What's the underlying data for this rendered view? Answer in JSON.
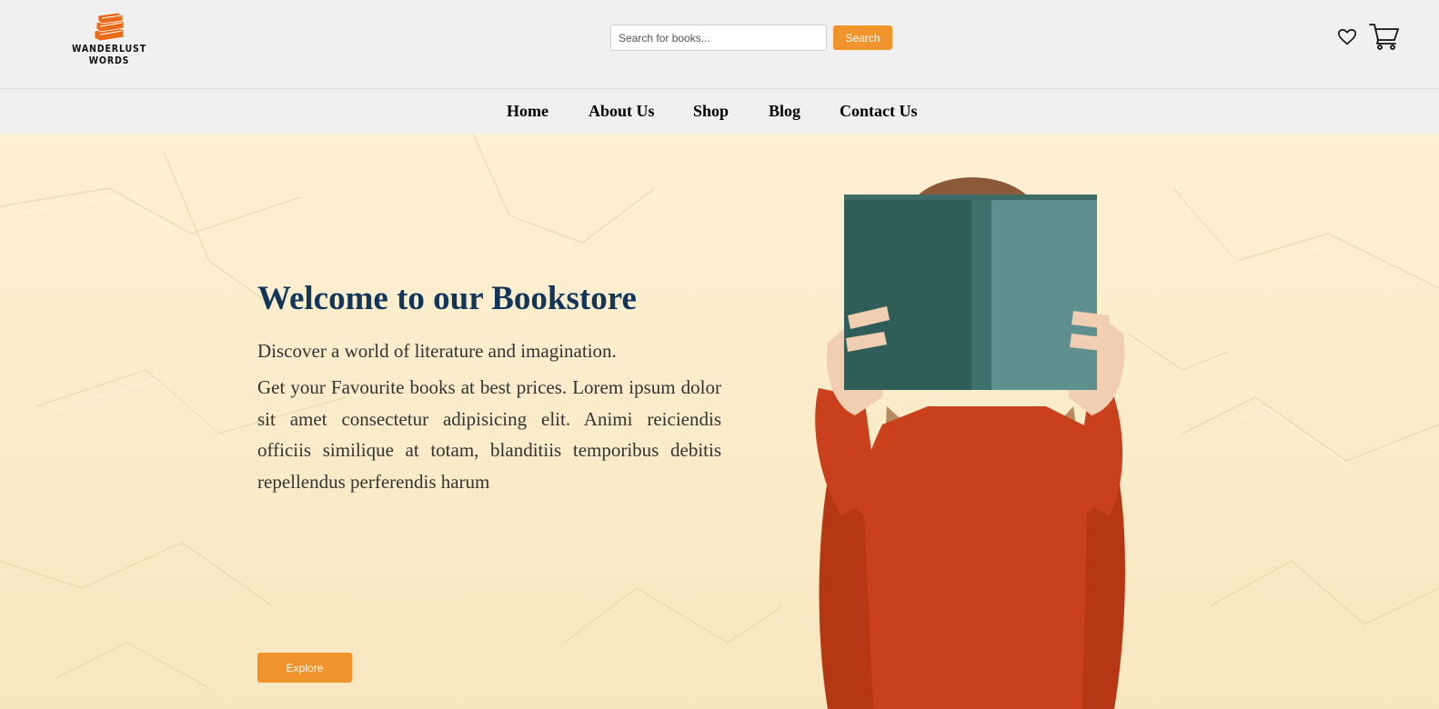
{
  "brand": {
    "name": "WANDERLUST WORDS",
    "logo_icon": "book-stack-icon",
    "accent": "#f0932b"
  },
  "search": {
    "placeholder": "Search for books...",
    "value": "",
    "button_label": "Search"
  },
  "header_icons": {
    "wishlist": "heart-icon",
    "cart": "cart-icon"
  },
  "nav": {
    "items": [
      {
        "label": "Home"
      },
      {
        "label": "About Us"
      },
      {
        "label": "Shop"
      },
      {
        "label": "Blog"
      },
      {
        "label": "Contact Us"
      }
    ]
  },
  "hero": {
    "title": "Welcome to our Bookstore",
    "line1": "Discover a world of literature and imagination.",
    "paragraph": "Get your Favourite books at best prices. Lorem ipsum dolor sit amet consectetur adipisicing elit. Animi reiciendis officiis similique at totam, blanditiis temporibus debitis repellendus perferendis harum",
    "button_label": "Explore",
    "title_color": "#12365a",
    "background_color": "#fbecc8"
  }
}
